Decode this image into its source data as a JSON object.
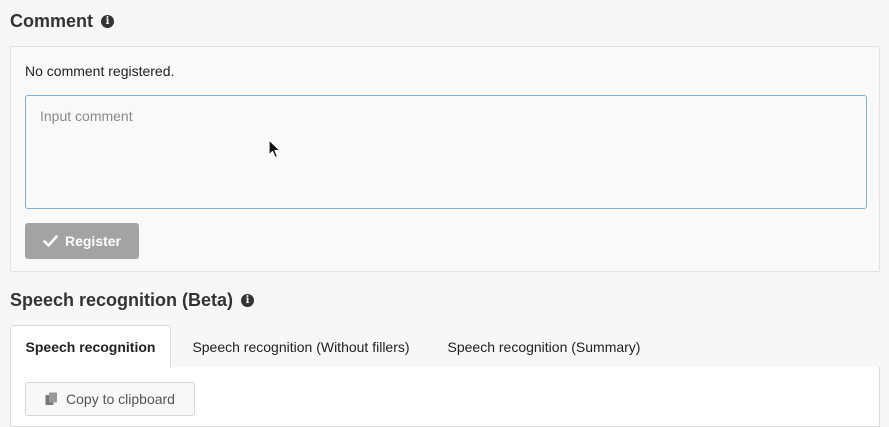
{
  "comment": {
    "title": "Comment",
    "empty_message": "No comment registered.",
    "input_placeholder": "Input comment",
    "input_value": "",
    "register_label": "Register"
  },
  "speech": {
    "title": "Speech recognition (Beta)",
    "tabs": [
      {
        "label": "Speech recognition",
        "active": true
      },
      {
        "label": "Speech recognition (Without fillers)",
        "active": false
      },
      {
        "label": "Speech recognition (Summary)",
        "active": false
      }
    ],
    "copy_label": "Copy to clipboard"
  },
  "icons": {
    "info": "info-icon",
    "check": "check-icon",
    "copy": "copy-icon",
    "cursor": "mouse-pointer-icon"
  },
  "colors": {
    "register_bg": "#a3a3a3",
    "input_border": "#7fb2d0"
  }
}
